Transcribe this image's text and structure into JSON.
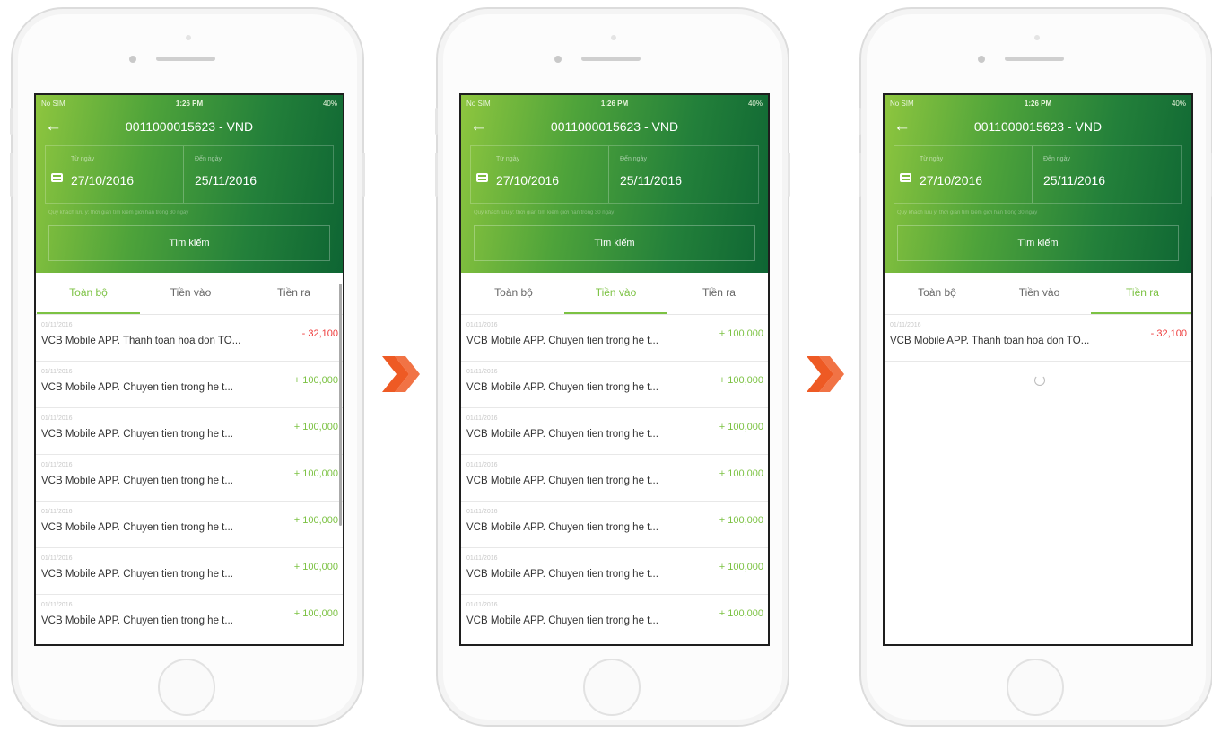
{
  "status": {
    "carrier": "No SIM",
    "time": "1:26 PM",
    "battery": "40%"
  },
  "header": {
    "back_icon": "←",
    "title": "0011000015623 - VND"
  },
  "dates": {
    "from_label": "Từ ngày",
    "from_value": "27/10/2016",
    "to_label": "Đến ngày",
    "to_value": "25/11/2016"
  },
  "note": "Quý khách lưu ý: thời gian tìm kiếm giới hạn trong 30 ngày",
  "search_button": "Tìm kiếm",
  "tabs": [
    "Toàn bộ",
    "Tiền vào",
    "Tiền ra"
  ],
  "transactions": {
    "payment": {
      "date": "01/11/2016",
      "desc": "VCB Mobile APP. Thanh toan hoa don TO...",
      "amount": "- 32,100"
    },
    "transfer": {
      "date": "01/11/2016",
      "desc": "VCB Mobile APP. Chuyen tien trong he t...",
      "amount": "+ 100,000"
    }
  },
  "screens": [
    {
      "active_tab": 0,
      "rows": [
        "payment",
        "transfer",
        "transfer",
        "transfer",
        "transfer",
        "transfer",
        "transfer"
      ],
      "scrollbar": true,
      "spinner": false
    },
    {
      "active_tab": 1,
      "rows": [
        "transfer",
        "transfer",
        "transfer",
        "transfer",
        "transfer",
        "transfer",
        "transfer"
      ],
      "scrollbar": false,
      "spinner": false
    },
    {
      "active_tab": 2,
      "rows": [
        "payment"
      ],
      "scrollbar": false,
      "spinner": true
    }
  ],
  "colors": {
    "brand_green": "#7cc243",
    "negative": "#ee3b3b",
    "arrow": "#ee5a24"
  },
  "icons": {
    "back": "back-arrow-icon",
    "calendar": "calendar-icon",
    "next": "double-chevron-right-icon",
    "loading": "loading-spinner-icon"
  }
}
